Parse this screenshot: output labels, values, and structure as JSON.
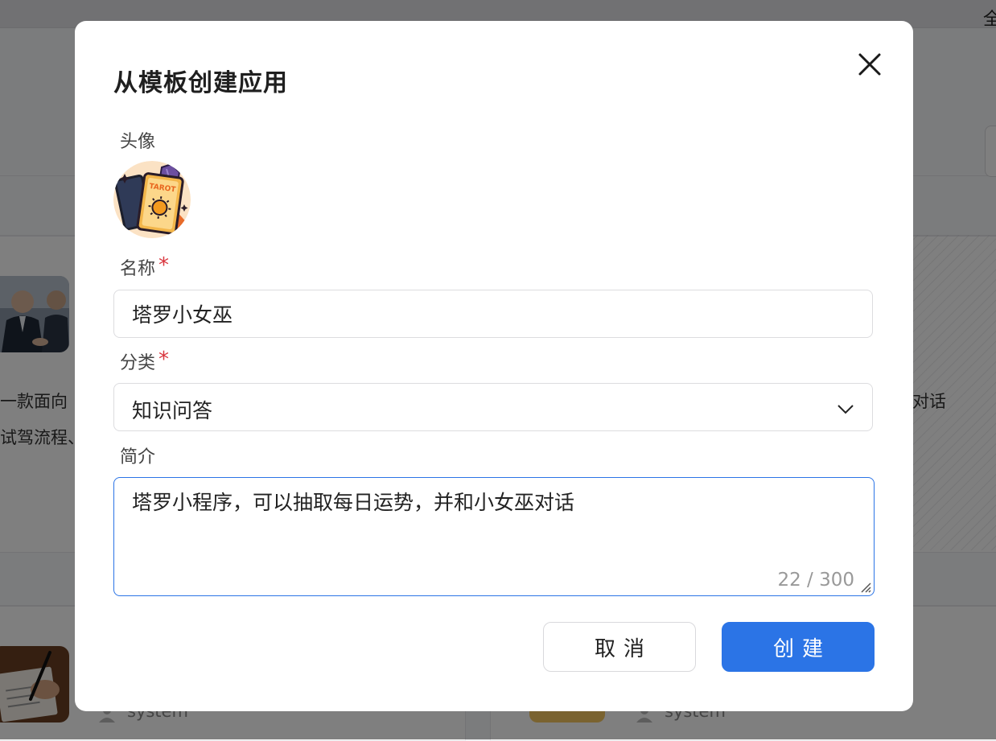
{
  "background": {
    "topbar_glyph": "全",
    "card_left_desc_line1": "一款面向",
    "card_left_desc_line2": "试驾流程、",
    "card_right_desc": "对话",
    "card_bottom_left_user": "system",
    "card_bottom_right_user": "system"
  },
  "modal": {
    "title": "从模板创建应用",
    "avatar_label": "头像",
    "avatar_text": "TAROT",
    "name_label": "名称",
    "name_value": "塔罗小女巫",
    "category_label": "分类",
    "category_value": "知识问答",
    "intro_label": "简介",
    "intro_value": "塔罗小程序，可以抽取每日运势，并和小女巫对话",
    "intro_counter": "22 / 300",
    "cancel_label": "取消",
    "create_label": "创建",
    "required_mark": "*"
  },
  "colors": {
    "primary": "#2b74e6",
    "required": "#d9363e",
    "overlay": "rgba(0,0,0,0.5)"
  }
}
